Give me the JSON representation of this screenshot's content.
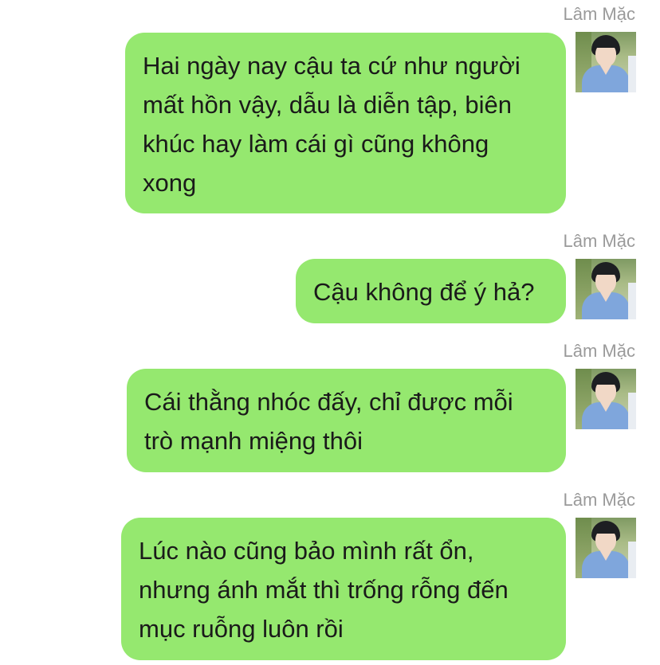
{
  "messages": [
    {
      "sender": "Lâm Mặc",
      "avatar": "avatar",
      "text": "Hai ngày nay cậu ta cứ như người mất hồn vậy, dẫu là diễn tập, biên khúc hay làm cái gì cũng không xong"
    },
    {
      "sender": "Lâm Mặc",
      "avatar": "avatar",
      "text": "Cậu không để ý hả?"
    },
    {
      "sender": "Lâm Mặc",
      "avatar": "avatar",
      "text": "Cái thằng nhóc đấy, chỉ được mỗi trò mạnh miệng thôi"
    },
    {
      "sender": "Lâm Mặc",
      "avatar": "avatar",
      "text": "Lúc nào cũng bảo mình rất ổn, nhưng ánh mắt thì trống rỗng đến mục ruỗng luôn rồi"
    }
  ],
  "colors": {
    "bubble": "#95e86f",
    "sender_name": "#9a9a9a",
    "background": "#ffffff"
  }
}
